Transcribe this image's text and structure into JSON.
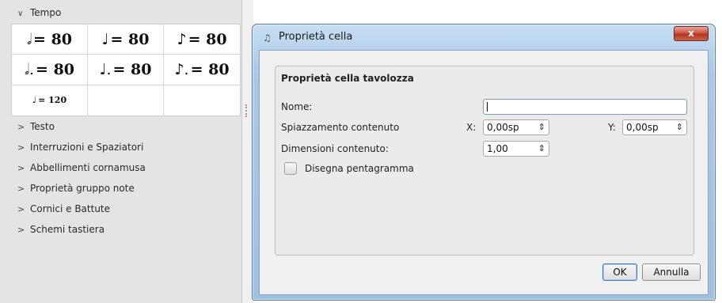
{
  "palette": {
    "tempo_label": "Tempo",
    "tempo_cells": [
      {
        "note": "𝅗𝅥",
        "text": "= 80"
      },
      {
        "note": "♩",
        "text": "= 80"
      },
      {
        "note": "♪",
        "text": "= 80"
      },
      {
        "note": "𝅗𝅥.",
        "text": "= 80"
      },
      {
        "note": "♩.",
        "text": "= 80"
      },
      {
        "note": "♪.",
        "text": "= 80"
      },
      {
        "note": "♩",
        "text": "= 120"
      },
      {
        "note": "",
        "text": ""
      },
      {
        "note": "",
        "text": ""
      }
    ],
    "sections": [
      "Testo",
      "Interruzioni e Spaziatori",
      "Abbellimenti cornamusa",
      "Proprietà gruppo note",
      "Cornici e Battute",
      "Schemi tastiera"
    ]
  },
  "dialog": {
    "title": "Proprietà cella",
    "close_label": "x",
    "group_title": "Proprietà cella tavolozza",
    "name_label": "Nome:",
    "name_value": "",
    "offset_label": "Spiazzamento contenuto",
    "x_label": "X:",
    "x_value": "0,00sp",
    "y_label": "Y:",
    "y_value": "0,00sp",
    "scale_label": "Dimensioni contenuto:",
    "scale_value": "1,00",
    "draw_staff_label": "Disegna pentagramma",
    "draw_staff_checked": false,
    "ok_label": "OK",
    "cancel_label": "Annulla"
  }
}
